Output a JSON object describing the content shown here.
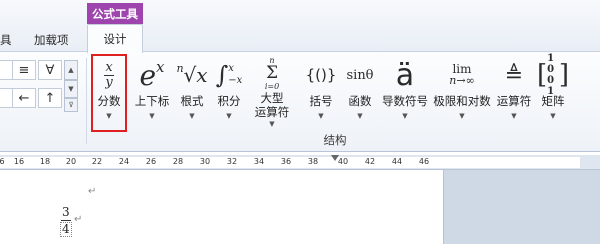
{
  "tabs": {
    "context_group": "公式工具",
    "left_partial": "具",
    "addins": "加载项",
    "design": "设计"
  },
  "symbols": {
    "row1": [
      "≡",
      "∀"
    ],
    "row2": [
      "←",
      "↑"
    ]
  },
  "ribbon_buttons": [
    {
      "id": "fraction",
      "label": "分数"
    },
    {
      "id": "script",
      "label": "上下标"
    },
    {
      "id": "radical",
      "label": "根式"
    },
    {
      "id": "integral",
      "label": "积分"
    },
    {
      "id": "large-operator",
      "label": "大型\n运算符"
    },
    {
      "id": "bracket",
      "label": "括号"
    },
    {
      "id": "function",
      "label": "函数"
    },
    {
      "id": "accent",
      "label": "导数符号"
    },
    {
      "id": "limit-log",
      "label": "极限和对数"
    },
    {
      "id": "operator",
      "label": "运算符"
    },
    {
      "id": "matrix",
      "label": "矩阵"
    }
  ],
  "glyphs": {
    "fraction_num": "x",
    "fraction_den": "y",
    "script": "e",
    "script_sup": "x",
    "radical_index": "n",
    "radical": "√x",
    "integral": "∫",
    "integral_upper": "x",
    "integral_lower": "−x",
    "large_op_upper": "n",
    "large_op": "Σ",
    "large_op_lower": "i=0",
    "bracket": "{()}",
    "function": "sinθ",
    "accent": "ä",
    "limit_top": "lim",
    "limit_bottom": "n→∞",
    "operator": "≜",
    "matrix_row1": "1 0",
    "matrix_row2": "0 1"
  },
  "group_label": "结构",
  "ruler_ticks": [
    "16",
    "18",
    "20",
    "22",
    "24",
    "26",
    "28",
    "30",
    "32",
    "34",
    "36",
    "38",
    "40",
    "42",
    "44",
    "46"
  ],
  "ruler_left_partial": "6",
  "document": {
    "paragraph_mark": "↵",
    "fraction_numerator": "3",
    "fraction_denominator": "4"
  },
  "colors": {
    "context_tab": "#9d45ad",
    "highlight_box": "#e02020",
    "ribbon_bg": "#eef2f8",
    "doc_bg": "#cfd9e6"
  }
}
